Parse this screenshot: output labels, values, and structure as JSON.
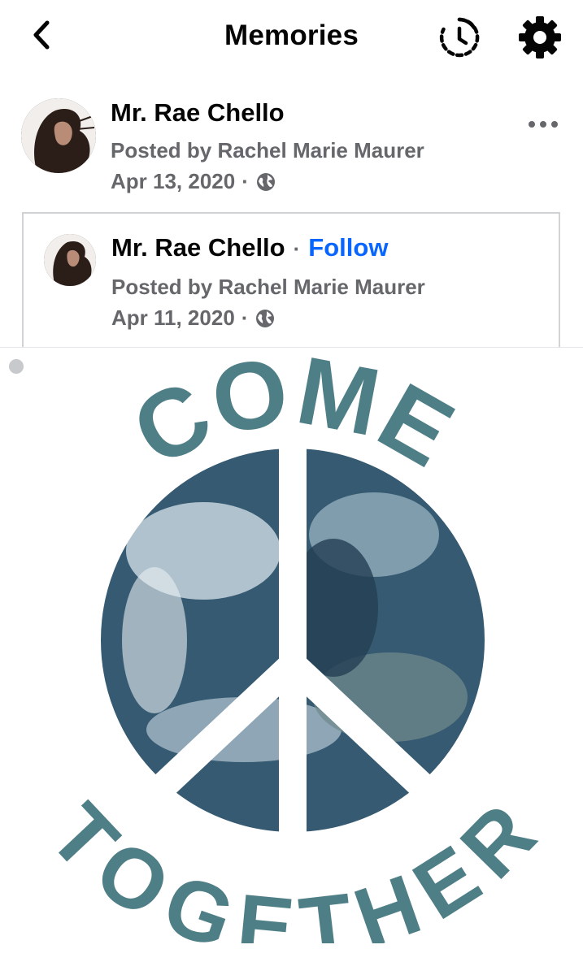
{
  "header": {
    "title": "Memories",
    "back_icon": "chevron-left-icon",
    "history_icon": "clock-history-icon",
    "settings_icon": "gear-icon"
  },
  "post": {
    "author": "Mr. Rae Chello",
    "posted_by": "Posted by Rachel Marie Maurer",
    "date": "Apr 13, 2020",
    "separator": "·",
    "privacy_icon": "globe-icon",
    "more_icon": "more-horizontal-icon"
  },
  "shared_post": {
    "author": "Mr. Rae Chello",
    "separator": "·",
    "follow_label": "Follow",
    "posted_by": "Posted by Rachel Marie Maurer",
    "date": "Apr 11, 2020",
    "privacy_icon": "globe-icon"
  },
  "image": {
    "top_text": "COME",
    "bottom_text": "TOGETHER",
    "colors": {
      "text": "#4f7f86",
      "ocean": "#355a71",
      "cloud": "#d9e6ee"
    }
  },
  "colors": {
    "accent": "#0866ff",
    "secondary_text": "#65676b",
    "primary_text": "#050505",
    "border": "#d0d2d6"
  }
}
